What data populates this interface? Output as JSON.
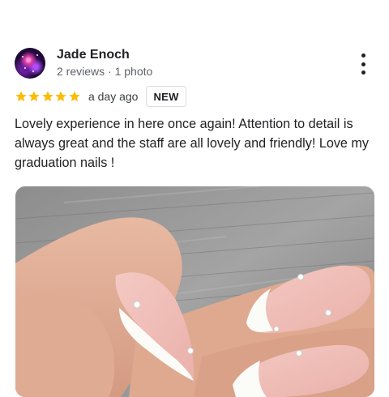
{
  "review": {
    "author": {
      "name": "Jade Enoch",
      "meta": "2 reviews · 1 photo"
    },
    "rating": {
      "stars": 5,
      "max": 5,
      "color": "#fbbc04"
    },
    "time": "a day ago",
    "badge": "NEW",
    "text": "Lovely experience in here once again! Attention to detail is always great and the staff are all lovely and friendly! Love my graduation nails !",
    "photo": {
      "subject": "almond french tip manicure with rhinestones"
    }
  },
  "icons": {
    "more": "more-vert-icon",
    "star": "star-icon",
    "avatar": "avatar-image"
  }
}
